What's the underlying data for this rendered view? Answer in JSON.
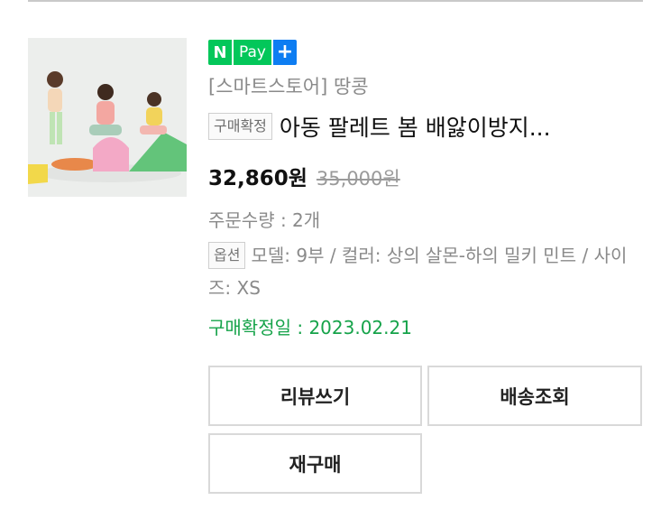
{
  "product": {
    "image_alt": "children playing on colorful soft blocks",
    "npay": {
      "n": "N",
      "pay": "Pay",
      "plus": "+"
    },
    "store_name": "[스마트스토어] 땅콩",
    "status_tag": "구매확정",
    "title": "아동 팔레트 봄 배앓이방지...",
    "price": "32,860원",
    "original_price": "35,000원",
    "quantity": "주문수량 : 2개",
    "option_tag": "옵션",
    "option_text": "모델: 9부 / 컬러: 상의 살몬-하의 밀키 민트 / 사이즈: XS",
    "confirm_date": "구매확정일 : 2023.02.21"
  },
  "actions": {
    "review": "리뷰쓰기",
    "track": "배송조회",
    "rebuy": "재구매"
  },
  "colors": {
    "npay_green": "#03c75a",
    "npay_plus_blue": "#0d7df2",
    "confirm_green": "#16a34a"
  }
}
